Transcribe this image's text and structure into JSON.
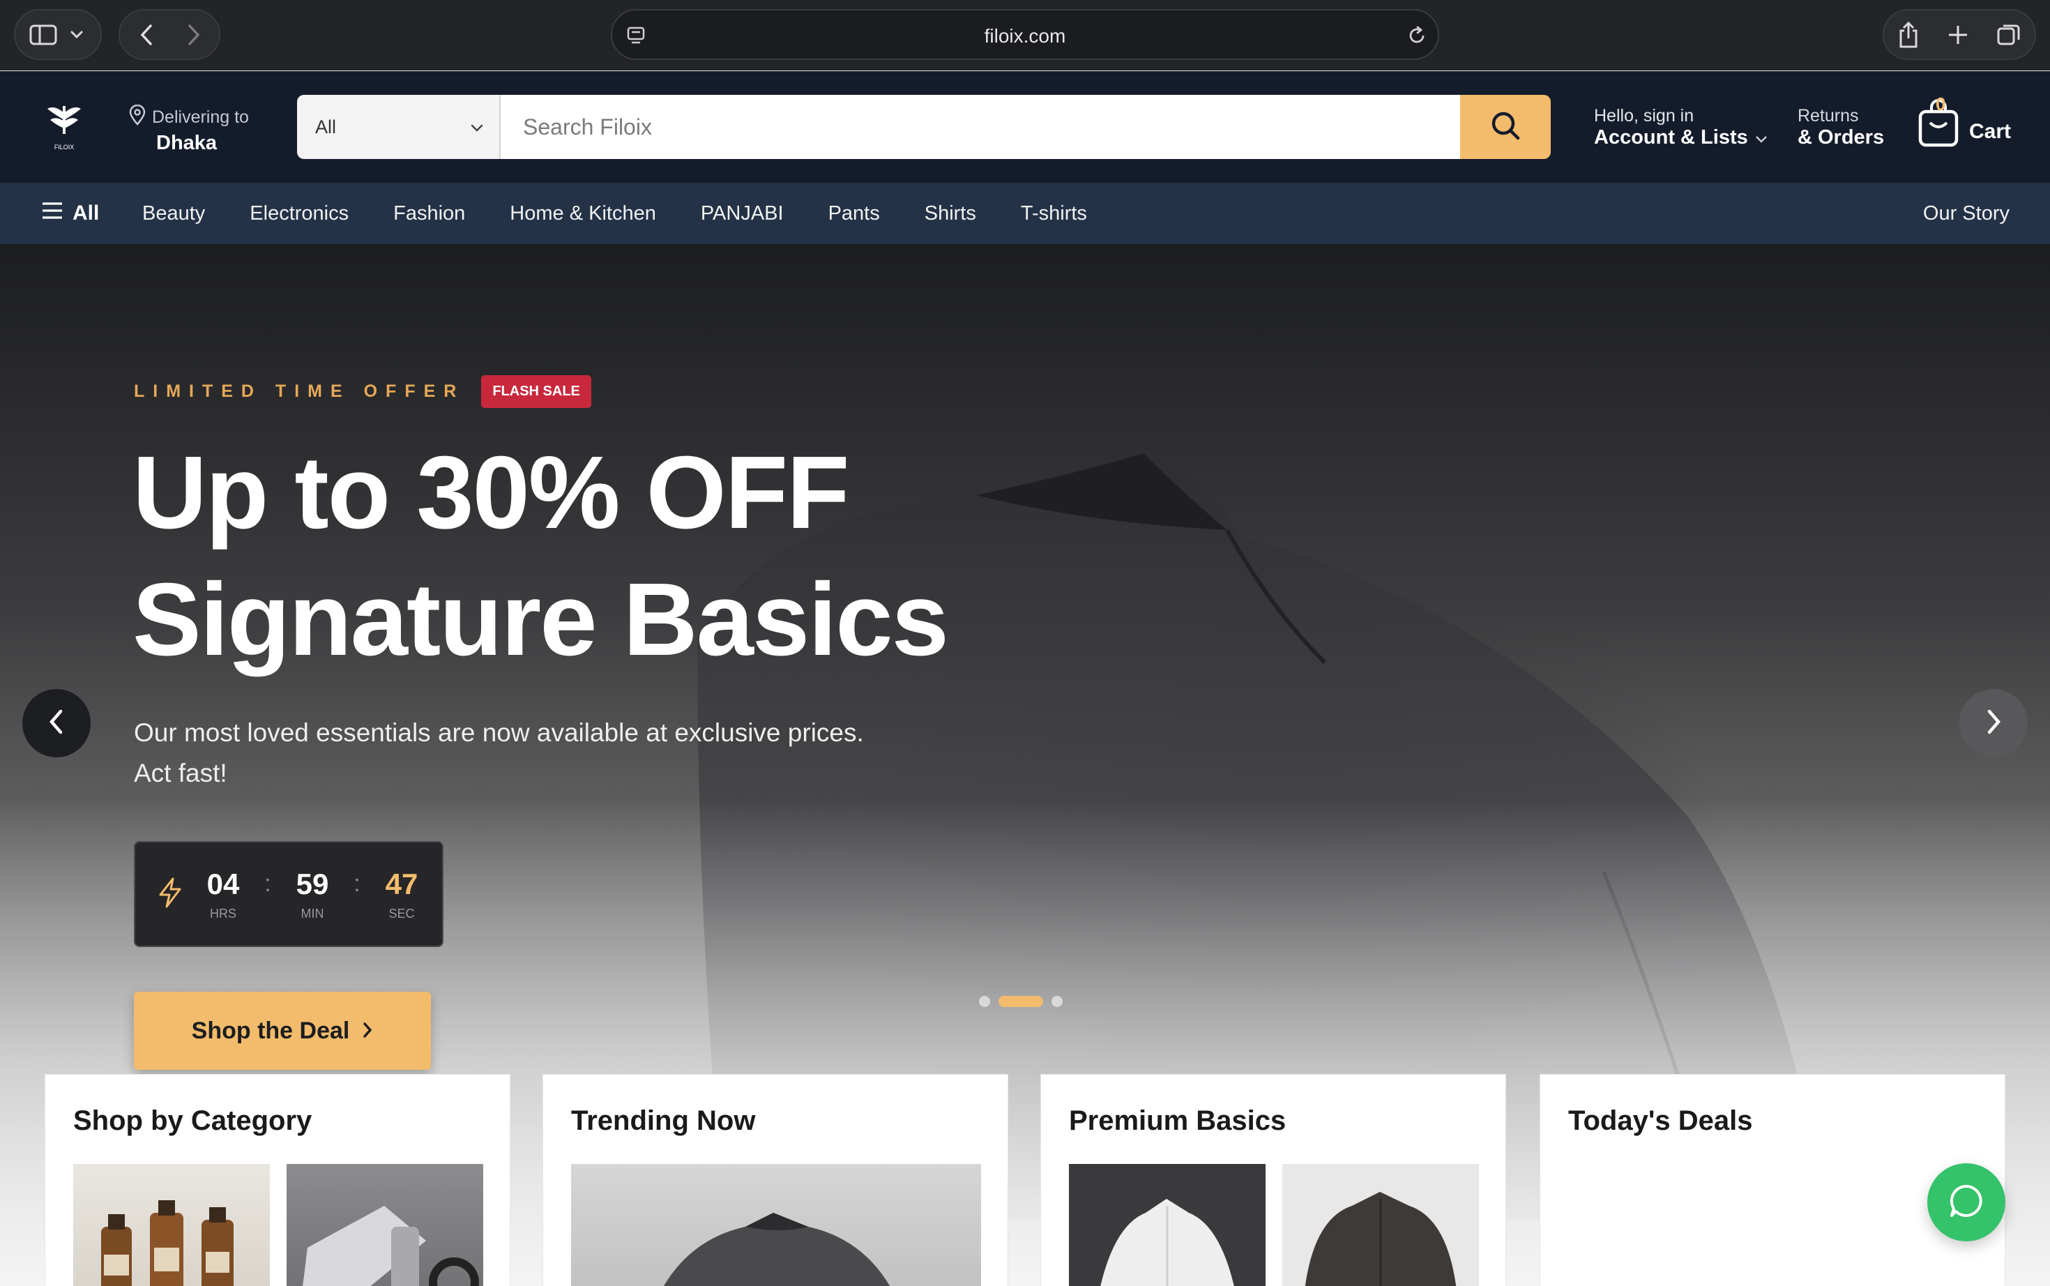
{
  "browser": {
    "url": "filoix.com"
  },
  "header": {
    "logo_text": "FILOIX",
    "deliver_label": "Delivering to",
    "deliver_city": "Dhaka",
    "search_category": "All",
    "search_placeholder": "Search Filoix",
    "account_line1": "Hello, sign in",
    "account_line2": "Account & Lists",
    "returns_line1": "Returns",
    "returns_line2": "& Orders",
    "cart_count": "0",
    "cart_label": "Cart"
  },
  "nav": {
    "all_label": "All",
    "items": [
      "Beauty",
      "Electronics",
      "Fashion",
      "Home & Kitchen",
      "PANJABI",
      "Pants",
      "Shirts",
      "T-shirts"
    ],
    "right_label": "Our Story"
  },
  "hero": {
    "eyebrow": "LIMITED TIME OFFER",
    "badge": "FLASH SALE",
    "title_line1": "Up to 30% OFF",
    "title_line2": "Signature Basics",
    "subtitle_line1": "Our most loved essentials are now available at exclusive prices.",
    "subtitle_line2": "Act fast!",
    "countdown": {
      "hours": "04",
      "hours_label": "HRS",
      "minutes": "59",
      "minutes_label": "MIN",
      "seconds": "47",
      "seconds_label": "SEC"
    },
    "cta_label": "Shop the Deal",
    "slide_total": 3,
    "slide_active": 2
  },
  "cards": [
    {
      "title": "Shop by Category"
    },
    {
      "title": "Trending Now"
    },
    {
      "title": "Premium Basics"
    },
    {
      "title": "Today's Deals"
    }
  ],
  "colors": {
    "accent": "#f3bc6c",
    "header_bg": "#141c2b",
    "nav_bg": "#243247",
    "flash_badge": "#c8283c",
    "chat": "#34c26a"
  }
}
